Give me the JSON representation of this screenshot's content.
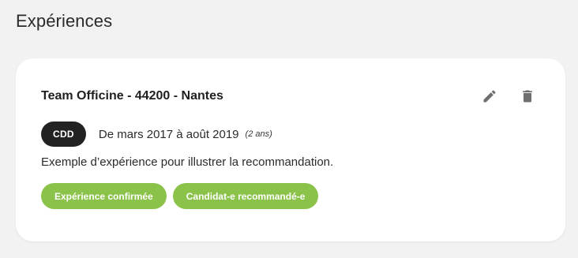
{
  "section": {
    "title": "Expériences"
  },
  "experience": {
    "title": "Team Officine - 44200 - Nantes",
    "contract_type": "CDD",
    "period": "De mars 2017 à août 2019",
    "duration": "(2 ans)",
    "description": "Exemple d’expérience pour illustrer la recommandation.",
    "tags": [
      {
        "label": "Expérience confirmée"
      },
      {
        "label": "Candidat-e recommandé-e"
      }
    ],
    "actions": {
      "edit_icon": "pencil-icon",
      "delete_icon": "trash-icon"
    }
  },
  "colors": {
    "background": "#f2f2f2",
    "card": "#ffffff",
    "badge_dark": "#222222",
    "tag_green": "#8bc34a",
    "icon_gray": "#6e6e6e"
  }
}
